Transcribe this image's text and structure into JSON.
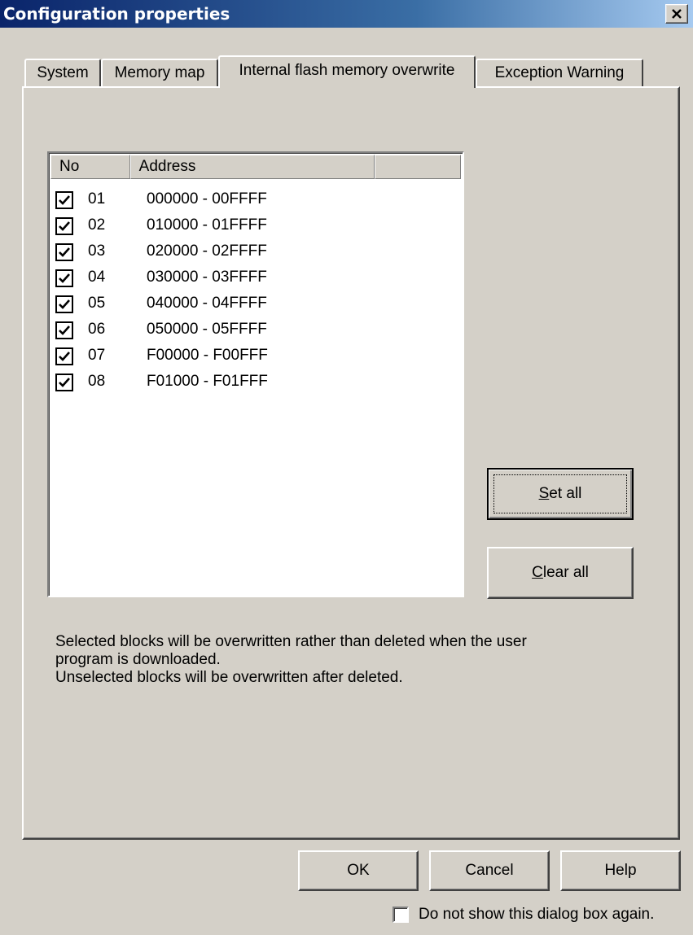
{
  "window": {
    "title": "Configuration properties"
  },
  "tabs": [
    {
      "label": "System"
    },
    {
      "label": "Memory map"
    },
    {
      "label": "Internal flash memory overwrite",
      "active": true
    },
    {
      "label": "Exception Warning"
    }
  ],
  "list": {
    "columns": [
      "No",
      "Address",
      ""
    ],
    "rows": [
      {
        "checked": true,
        "no": "01",
        "address": "000000 - 00FFFF"
      },
      {
        "checked": true,
        "no": "02",
        "address": "010000 - 01FFFF"
      },
      {
        "checked": true,
        "no": "03",
        "address": "020000 - 02FFFF"
      },
      {
        "checked": true,
        "no": "04",
        "address": "030000 - 03FFFF"
      },
      {
        "checked": true,
        "no": "05",
        "address": "040000 - 04FFFF"
      },
      {
        "checked": true,
        "no": "06",
        "address": "050000 - 05FFFF"
      },
      {
        "checked": true,
        "no": "07",
        "address": "F00000 - F00FFF"
      },
      {
        "checked": true,
        "no": "08",
        "address": "F01000 - F01FFF"
      }
    ]
  },
  "buttons": {
    "set_all_key": "S",
    "set_all_rest": "et all",
    "clear_all_key": "C",
    "clear_all_rest": "lear all",
    "ok": "OK",
    "cancel": "Cancel",
    "help": "Help"
  },
  "note": {
    "line1": "Selected blocks will be overwritten rather than deleted when the user",
    "line2": "program is downloaded.",
    "line3": "Unselected blocks will be overwritten after deleted."
  },
  "footer": {
    "dont_show_label": "Do not show this dialog box again.",
    "dont_show_checked": false
  },
  "colors": {
    "face": "#d4d0c8",
    "title_start": "#0a246a",
    "title_end": "#a6caf0"
  }
}
